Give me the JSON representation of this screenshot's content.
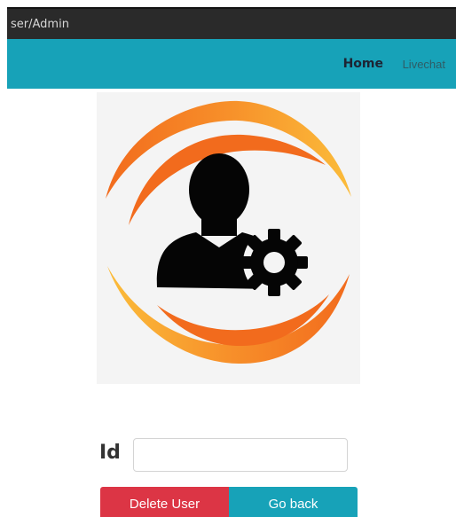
{
  "window": {
    "address_text": "ser/Admin"
  },
  "navbar": {
    "home_label": "Home",
    "livechat_label": "Livechat",
    "background": "#17a2b8"
  },
  "hero": {
    "icon": "admin-user-gear-icon",
    "ring_colors": [
      "#fbbc3a",
      "#f26b1d"
    ]
  },
  "form": {
    "id_label": "Id",
    "id_value": "",
    "id_placeholder": ""
  },
  "buttons": {
    "delete_label": "Delete User",
    "delete_color": "#dc3545",
    "back_label": "Go back",
    "back_color": "#17a2b8"
  }
}
